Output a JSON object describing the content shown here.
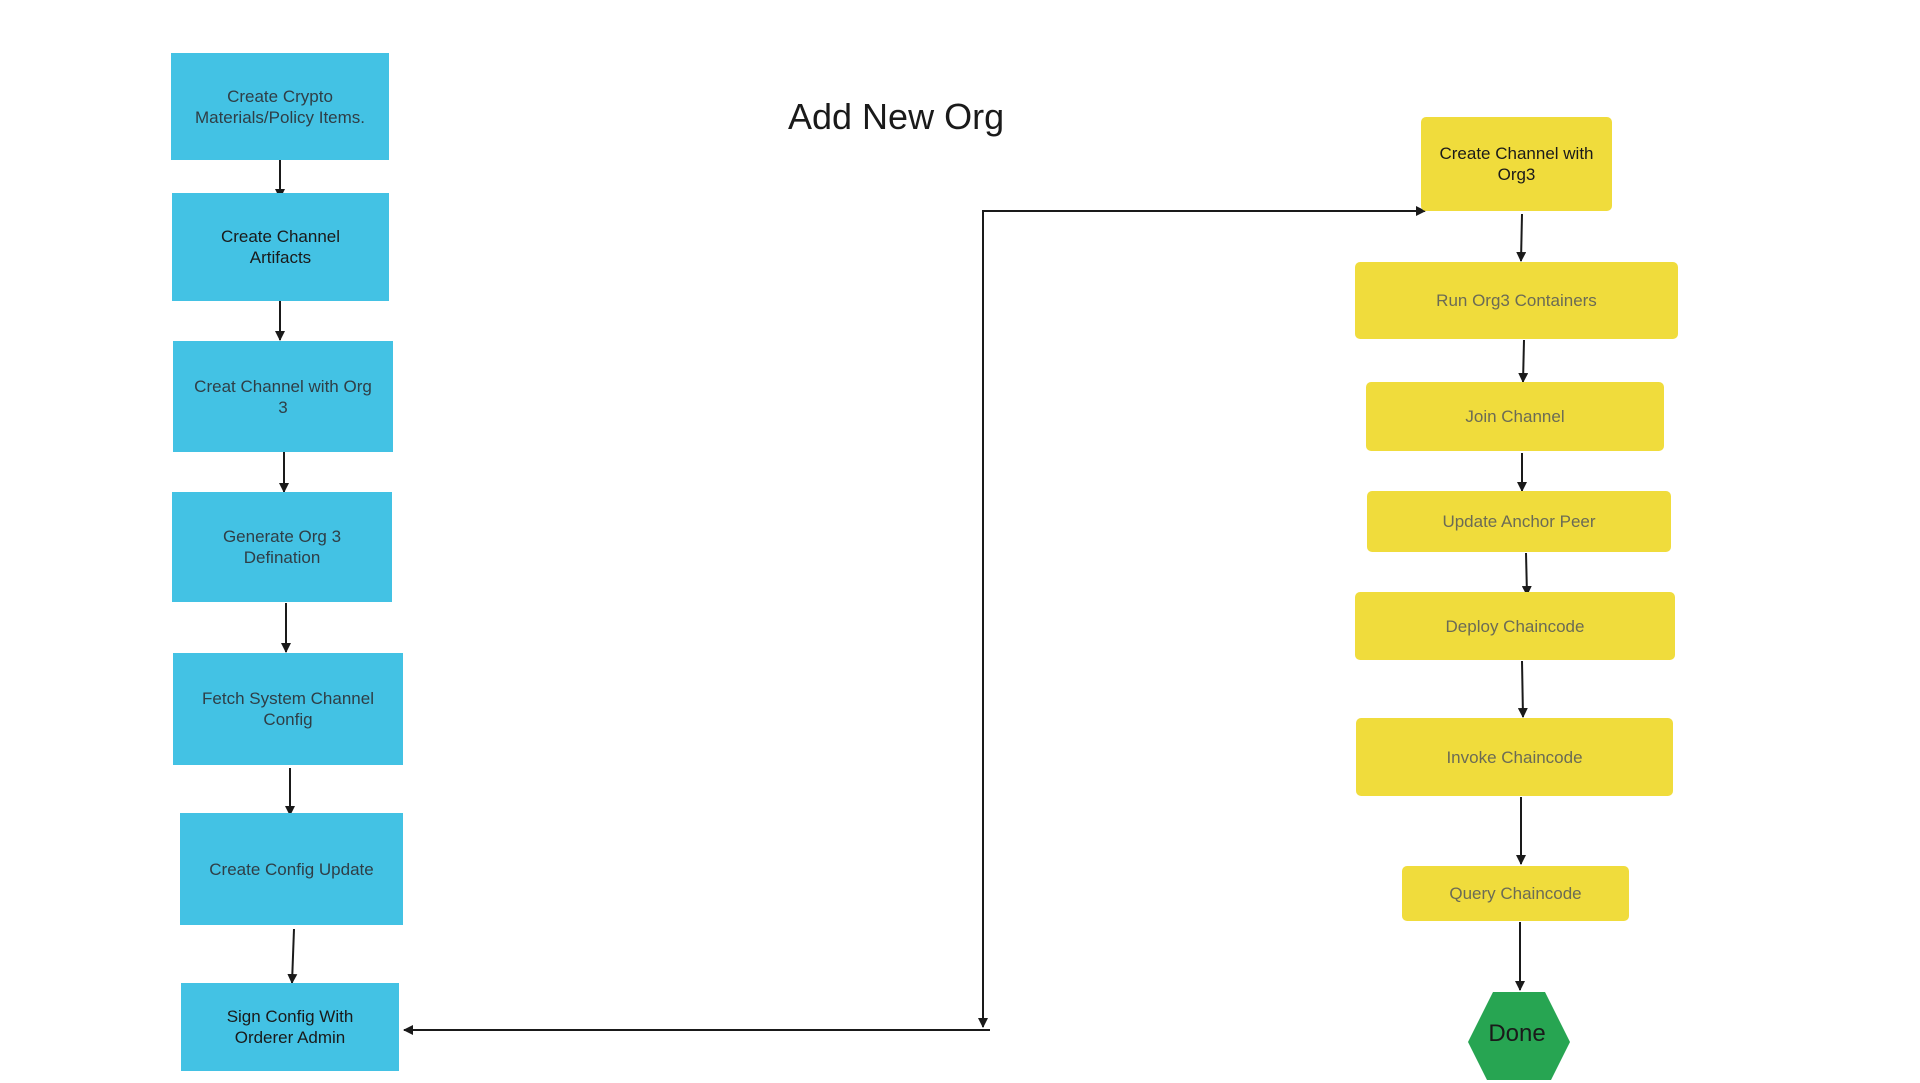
{
  "title": "Add New Org",
  "colors": {
    "blue_box": "#43c2e4",
    "yellow_box": "#f0dc3c",
    "done_hex": "#27a552",
    "arrow": "#1a1a1a"
  },
  "left_flow": [
    {
      "line1": "Create Crypto",
      "line2": "Materials/Policy Items."
    },
    {
      "line1": "Create Channel",
      "line2": "Artifacts"
    },
    {
      "line1": "Creat Channel with Org",
      "line2": "3"
    },
    {
      "line1": "Generate Org 3",
      "line2": "Defination"
    },
    {
      "line1": "Fetch System Channel",
      "line2": "Config"
    },
    {
      "line1": "Create Config Update",
      "line2": ""
    },
    {
      "line1": "Sign Config With",
      "line2": "Orderer Admin"
    }
  ],
  "right_flow": [
    {
      "line1": "Create Channel with",
      "line2": "Org3"
    },
    {
      "line1": "Run Org3 Containers",
      "line2": ""
    },
    {
      "line1": "Join Channel",
      "line2": ""
    },
    {
      "line1": "Update Anchor Peer",
      "line2": ""
    },
    {
      "line1": "Deploy Chaincode",
      "line2": ""
    },
    {
      "line1": "Invoke Chaincode",
      "line2": ""
    },
    {
      "line1": "Query Chaincode",
      "line2": ""
    }
  ],
  "terminal": {
    "label": "Done",
    "shape": "hexagon"
  }
}
